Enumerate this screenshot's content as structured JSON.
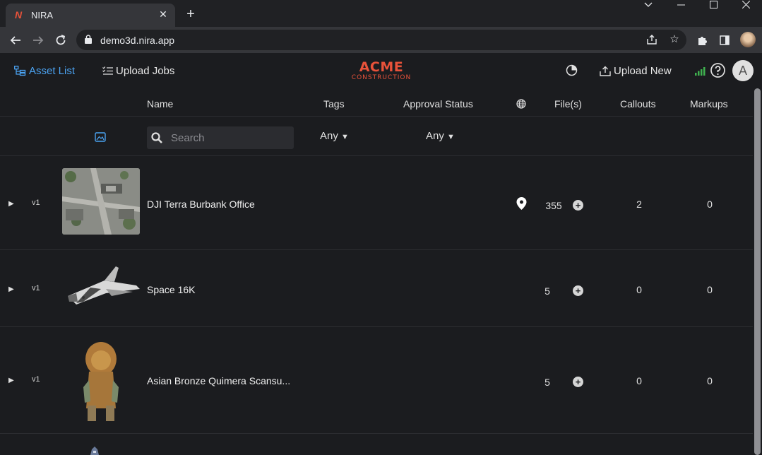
{
  "browser": {
    "tab_title": "NIRA",
    "url": "demo3d.nira.app"
  },
  "app": {
    "nav": {
      "asset_list": "Asset List",
      "upload_jobs": "Upload Jobs",
      "upload_new": "Upload New"
    },
    "logo": {
      "line1": "ACME",
      "line2": "CONSTRUCTION"
    },
    "avatar_letter": "A",
    "brand_color": "#e8523a",
    "accent_color": "#4ba3f2"
  },
  "table": {
    "headers": {
      "name": "Name",
      "tags": "Tags",
      "approval": "Approval Status",
      "files": "File(s)",
      "callouts": "Callouts",
      "markups": "Markups"
    },
    "filters": {
      "search_placeholder": "Search",
      "tags_value": "Any",
      "approval_value": "Any"
    },
    "rows": [
      {
        "version": "v1",
        "name": "DJI Terra Burbank Office",
        "has_location": true,
        "files": "355",
        "callouts": "2",
        "markups": "0"
      },
      {
        "version": "v1",
        "name": "Space 16K",
        "has_location": false,
        "files": "5",
        "callouts": "0",
        "markups": "0"
      },
      {
        "version": "v1",
        "name": "Asian Bronze Quimera Scansu...",
        "has_location": false,
        "files": "5",
        "callouts": "0",
        "markups": "0"
      }
    ]
  }
}
